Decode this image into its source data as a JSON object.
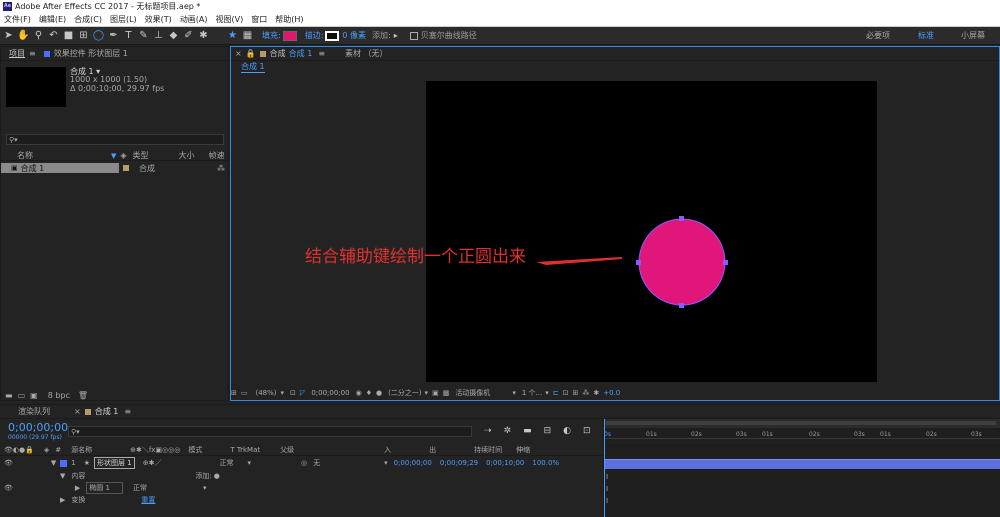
{
  "window": {
    "title": "Adobe After Effects CC 2017 - 无标题项目.aep *",
    "logo": "Ae"
  },
  "menu": [
    "文件(F)",
    "编辑(E)",
    "合成(C)",
    "图层(L)",
    "效果(T)",
    "动画(A)",
    "视图(V)",
    "窗口",
    "帮助(H)"
  ],
  "toolbar": {
    "fill_label": "填充:",
    "stroke_label": "描边:",
    "stroke_width": "0 像素",
    "add_label": "添加:",
    "bezier_label": "贝塞尔曲线路径",
    "workspace_essentials": "必要项",
    "workspace_standard": "标准",
    "workspace_small": "小屏幕",
    "fill_color": "#e0166f",
    "stroke_color": "#ffffff"
  },
  "project_panel": {
    "tab_project": "项目",
    "tab_effects": "效果控件 形状图层 1",
    "comp_name": "合成 1 ▾",
    "comp_size": "1000 x 1000 (1.50)",
    "comp_duration": "Δ 0;00;10;00, 29.97 fps",
    "col_name": "名称",
    "col_type": "类型",
    "col_size": "大小",
    "col_rate": "帧速",
    "item_name": "合成 1",
    "item_type": "合成",
    "bpc": "8 bpc"
  },
  "viewer": {
    "tab_comp": "合成",
    "tab_comp_name": "合成 1",
    "tab_footage": "素材 （无）",
    "breadcrumb": "合成 1",
    "zoom": "(48%)",
    "timecode": "0;00;00;00",
    "resolution": "(二分之一)",
    "camera": "活动摄像机",
    "views": "1 个...",
    "exposure": "+0.0",
    "annotation": "结合辅助键绘制一个正圆出来",
    "annotation_color": "#e03030",
    "circle_color": "#e0167a",
    "circle_stroke": "#8a5cff"
  },
  "timeline": {
    "tab_render": "渲染队列",
    "tab_comp": "合成 1",
    "timecode": "0;00;00;00",
    "fps": "00000 (29.97 fps)",
    "col_layer_name": "源名称",
    "col_mode": "模式",
    "col_trkmat": "T  TrkMat",
    "col_parent": "父级",
    "col_in": "入",
    "col_out": "出",
    "col_duration": "持续时间",
    "col_stretch": "伸缩",
    "layer_num": "1",
    "layer_name": "形状图层 1",
    "layer_mode": "正常",
    "layer_parent": "无",
    "layer_in": "0;00;00;00",
    "layer_out": "0;00;09;29",
    "layer_duration": "0;00;10;00",
    "layer_stretch": "100.0%",
    "contents_label": "内容",
    "add_label": "添加:",
    "ellipse_label": "椭圆 1",
    "ellipse_mode": "正常",
    "transform_label": "变换",
    "reset_label": "重置",
    "ruler_ticks": [
      "0s",
      "01s",
      "02s",
      "03s",
      "01s",
      "02s",
      "03s",
      "01s",
      "02s",
      "03s"
    ]
  }
}
